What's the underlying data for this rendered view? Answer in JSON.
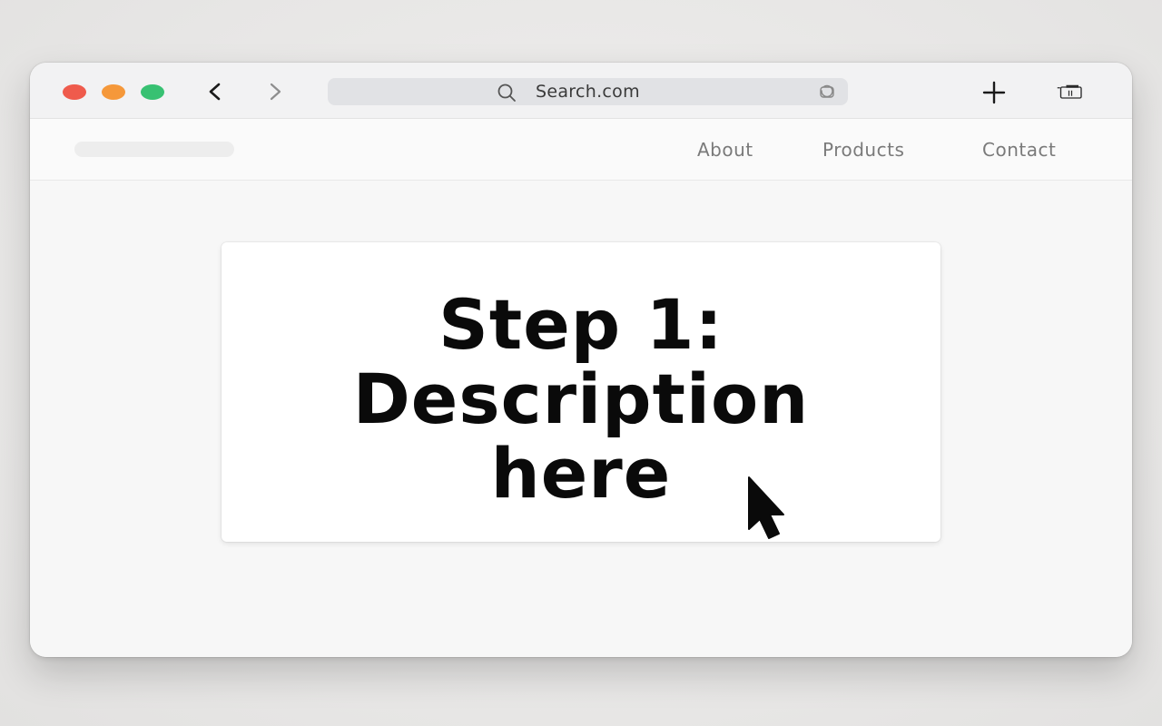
{
  "browser": {
    "traffic_lights": {
      "close_color": "#ef5b4c",
      "minimize_color": "#f5983a",
      "maximize_color": "#38c172"
    },
    "back_icon": "chevron-left-icon",
    "forward_icon": "chevron-right-icon",
    "address_bar": {
      "text": "Search.com",
      "search_icon": "search-icon",
      "reload_icon": "reload-icon"
    },
    "new_tab_icon": "plus-icon",
    "tabs_icon": "tab-overview-icon"
  },
  "site": {
    "nav": {
      "links": [
        "About",
        "Products",
        "Contact"
      ]
    }
  },
  "card": {
    "title_line1": "Step 1:",
    "title_line2": "Description",
    "title_line3": "here"
  },
  "cursor_icon": "mouse-pointer-icon"
}
